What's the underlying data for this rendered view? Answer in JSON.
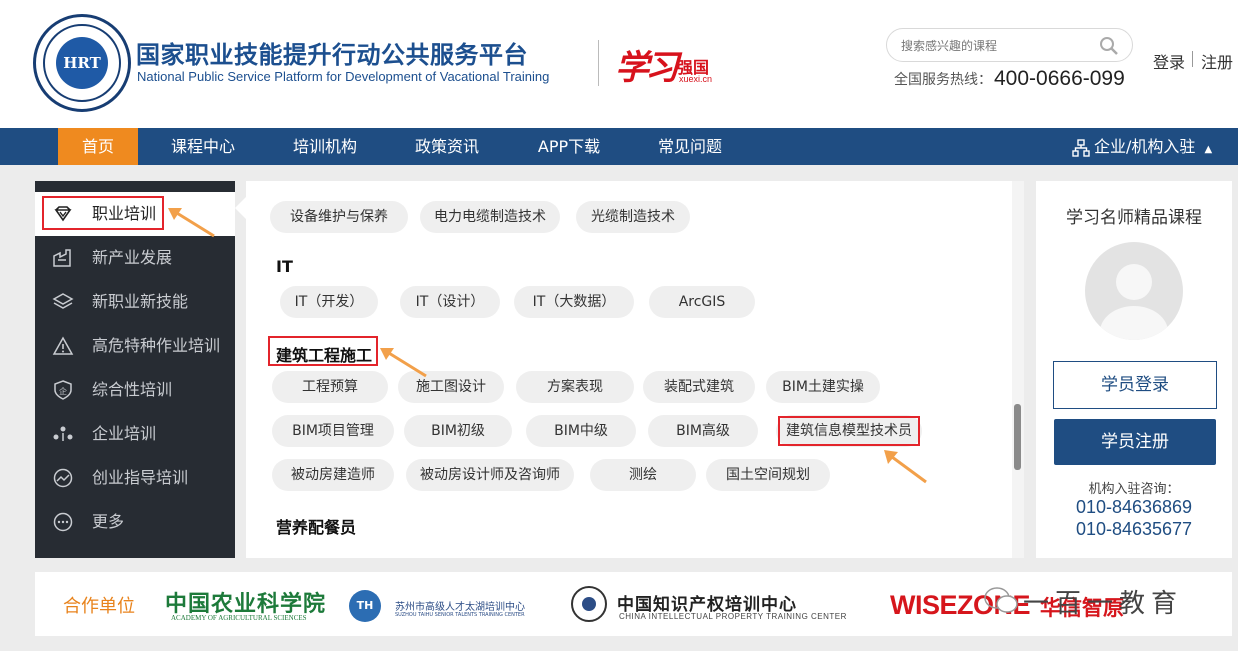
{
  "header": {
    "site_title_cn": "国家职业技能提升行动公共服务平台",
    "site_title_en": "National Public Service Platform for Development of Vacational Training",
    "seal_core": "HRT",
    "xuexi_script": "学习",
    "xuexi_qiangguo": "强国",
    "xuexi_domain": "xuexi.cn",
    "search_placeholder": "搜索感兴趣的课程",
    "hotline_label": "全国服务热线：",
    "hotline_number": "400-0666-099",
    "login": "登录",
    "register": "注册"
  },
  "nav": {
    "items": [
      {
        "label": "首页",
        "active": true
      },
      {
        "label": "课程中心"
      },
      {
        "label": "培训机构"
      },
      {
        "label": "政策资讯"
      },
      {
        "label": "APP下载"
      },
      {
        "label": "常见问题"
      }
    ],
    "enterprise_entry": "企业/机构入驻"
  },
  "sidebar": {
    "items": [
      {
        "label": "职业培训",
        "icon": "diamond-icon",
        "active": true
      },
      {
        "label": "新产业发展",
        "icon": "factory-icon"
      },
      {
        "label": "新职业新技能",
        "icon": "layers-icon"
      },
      {
        "label": "高危特种作业培训",
        "icon": "warning-icon"
      },
      {
        "label": "综合性培训",
        "icon": "shield-icon"
      },
      {
        "label": "企业培训",
        "icon": "people-icon"
      },
      {
        "label": "创业指导培训",
        "icon": "trend-icon"
      },
      {
        "label": "更多",
        "icon": "more-icon"
      }
    ]
  },
  "panel": {
    "top_chips": [
      "设备维护与保养",
      "电力电缆制造技术",
      "光缆制造技术"
    ],
    "sections": [
      {
        "heading": "IT",
        "chips": [
          "IT（开发）",
          "IT（设计）",
          "IT（大数据）",
          "ArcGIS"
        ]
      },
      {
        "heading": "建筑工程施工",
        "chips": [
          "工程预算",
          "施工图设计",
          "方案表现",
          "装配式建筑",
          "BIM土建实操",
          "BIM项目管理",
          "BIM初级",
          "BIM中级",
          "BIM高级",
          "建筑信息模型技术员",
          "被动房建造师",
          "被动房设计师及咨询师",
          "测绘",
          "国土空间规划"
        ]
      },
      {
        "heading": "营养配餐员",
        "chips": []
      }
    ]
  },
  "rightcard": {
    "title": "学习名师精品课程",
    "login_button": "学员登录",
    "register_button": "学员注册",
    "consult_label": "机构入驻咨询：",
    "phones": [
      "010-84636869",
      "010-84635677"
    ]
  },
  "partners": {
    "label": "合作单位",
    "caas_title": "中国农业科学院",
    "caas_sub": "ACADEMY OF AGRICULTURAL SCIENCES",
    "taihu_title": "苏州市高级人才太湖培训中心",
    "taihu_sub": "SUZHOU TAIHU SENIOR TALENTS TRAINING CENTER",
    "ip_title": "中国知识产权培训中心",
    "ip_sub": "CHINA INTELLECTUAL PROPERTY TRAINING CENTER",
    "wisezone": "WISEZONE",
    "hxzy": "华信智原"
  },
  "watermark": "一百一教育",
  "colors": {
    "nav_bg": "#1f4d82",
    "nav_active": "#ef8a1f",
    "sidebar_bg": "#272c33",
    "highlight_red": "#e3242b",
    "arrow_orange": "#f2a04a",
    "chip_bg": "#efefef"
  }
}
